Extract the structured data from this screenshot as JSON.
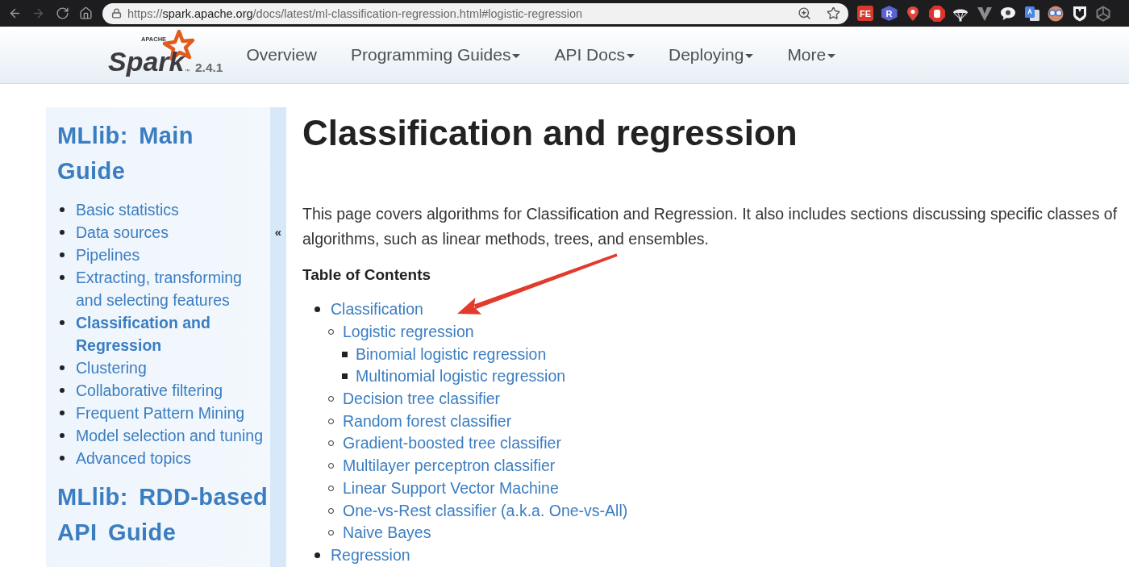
{
  "browser": {
    "nav_buttons": [
      {
        "kind": "back",
        "enabled": true
      },
      {
        "kind": "forward",
        "enabled": false
      },
      {
        "kind": "reload",
        "enabled": true
      },
      {
        "kind": "home",
        "enabled": true
      }
    ],
    "url": {
      "scheme": "https://",
      "host": "spark.apache.org",
      "path": "/docs/latest/ml-classification-regression.html#logistic-regression"
    },
    "extensions": [
      {
        "kind": "square-badge",
        "label": "FE"
      },
      {
        "kind": "hex-badge",
        "label": "R"
      },
      {
        "kind": "pin"
      },
      {
        "kind": "stop"
      },
      {
        "kind": "parachute"
      },
      {
        "kind": "v"
      },
      {
        "kind": "chat"
      },
      {
        "kind": "translate"
      },
      {
        "kind": "goggles"
      },
      {
        "kind": "shield"
      },
      {
        "kind": "knot"
      }
    ]
  },
  "header": {
    "logo": {
      "small": "APACHE",
      "name": "Spark",
      "mark": "™"
    },
    "version": "2.4.1",
    "nav": [
      {
        "label": "Overview",
        "menu": false
      },
      {
        "label": "Programming Guides",
        "menu": true
      },
      {
        "label": "API Docs",
        "menu": true
      },
      {
        "label": "Deploying",
        "menu": true
      },
      {
        "label": "More",
        "menu": true
      }
    ]
  },
  "sidebar": {
    "collapse_label": "«",
    "sections": [
      {
        "title": "MLlib: Main Guide",
        "items": [
          {
            "label": "Basic statistics",
            "selected": false
          },
          {
            "label": "Data sources",
            "selected": false
          },
          {
            "label": "Pipelines",
            "selected": false
          },
          {
            "label": "Extracting, transforming and selecting features",
            "selected": false
          },
          {
            "label": "Classification and Regression",
            "selected": true
          },
          {
            "label": "Clustering",
            "selected": false
          },
          {
            "label": "Collaborative filtering",
            "selected": false
          },
          {
            "label": "Frequent Pattern Mining",
            "selected": false
          },
          {
            "label": "Model selection and tuning",
            "selected": false
          },
          {
            "label": "Advanced topics",
            "selected": false
          }
        ]
      },
      {
        "title": "MLlib: RDD-based API Guide"
      }
    ]
  },
  "content": {
    "title": "Classification and regression",
    "intro": "This page covers algorithms for Classification and Regression. It also includes sections discussing specific classes of algorithms, such as linear methods, trees, and ensembles.",
    "toc": {
      "title": "Table of Contents",
      "items": [
        {
          "label": "Classification",
          "children": [
            {
              "label": "Logistic regression",
              "children": [
                {
                  "label": "Binomial logistic regression"
                },
                {
                  "label": "Multinomial logistic regression"
                }
              ]
            },
            {
              "label": "Decision tree classifier"
            },
            {
              "label": "Random forest classifier"
            },
            {
              "label": "Gradient-boosted tree classifier"
            },
            {
              "label": "Multilayer perceptron classifier"
            },
            {
              "label": "Linear Support Vector Machine"
            },
            {
              "label": "One-vs-Rest classifier (a.k.a. One-vs-All)"
            },
            {
              "label": "Naive Bayes"
            }
          ]
        },
        {
          "label": "Regression"
        }
      ]
    }
  },
  "annotation": {
    "kind": "arrow"
  }
}
